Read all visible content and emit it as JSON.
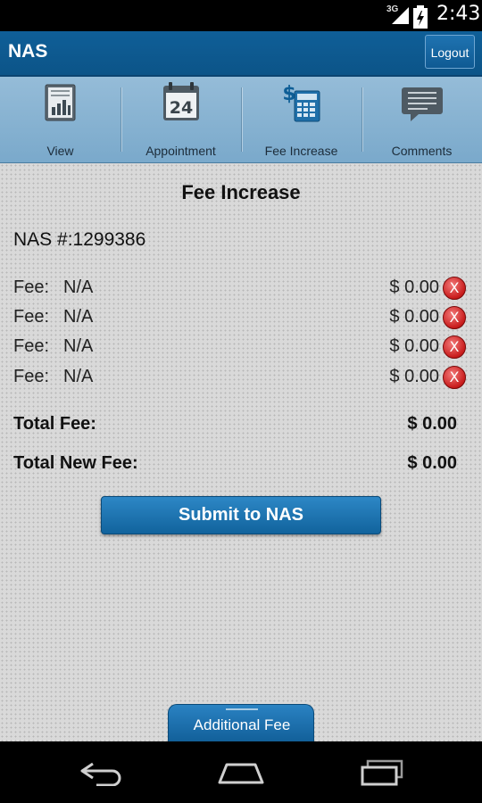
{
  "status_bar": {
    "network": "3G",
    "time": "2:43"
  },
  "app_bar": {
    "title": "NAS",
    "logout_label": "Logout"
  },
  "tabs": [
    {
      "label": "View",
      "icon": "report-icon"
    },
    {
      "label": "Appointment",
      "icon": "calendar-icon",
      "icon_text": "24"
    },
    {
      "label": "Fee Increase",
      "icon": "calculator-icon"
    },
    {
      "label": "Comments",
      "icon": "comment-icon"
    }
  ],
  "page": {
    "heading": "Fee Increase",
    "nas_number": "NAS #:1299386",
    "fees": [
      {
        "label": "Fee:",
        "value": "N/A",
        "amount": "$ 0.00",
        "remove": "X"
      },
      {
        "label": "Fee:",
        "value": "N/A",
        "amount": "$ 0.00",
        "remove": "X"
      },
      {
        "label": "Fee:",
        "value": "N/A",
        "amount": "$ 0.00",
        "remove": "X"
      },
      {
        "label": "Fee:",
        "value": "N/A",
        "amount": "$ 0.00",
        "remove": "X"
      }
    ],
    "total_fee_label": "Total Fee:",
    "total_fee_amount": "$ 0.00",
    "total_new_fee_label": "Total New Fee:",
    "total_new_fee_amount": "$ 0.00",
    "submit_label": "Submit to NAS",
    "drawer_label": "Additional Fee"
  },
  "colors": {
    "brand_blue": "#0f5f98",
    "tab_bar": "#8cb6d4",
    "remove_red": "#c81c1c",
    "content_bg": "#d9d9d9"
  }
}
